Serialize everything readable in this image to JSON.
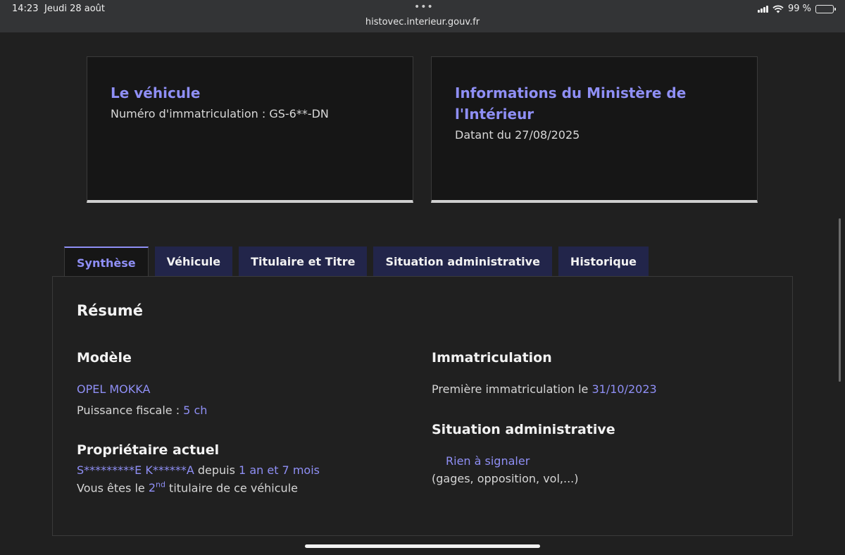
{
  "status_bar": {
    "time": "14:23",
    "date": "Jeudi 28 août",
    "battery": "99 %",
    "url": "histovec.interieur.gouv.fr"
  },
  "cards": {
    "vehicle": {
      "title": "Le véhicule",
      "text": "Numéro d'immatriculation : GS-6**-DN"
    },
    "ministry": {
      "title_line1": "Informations du Ministère de",
      "title_line2": "l'Intérieur",
      "text": "Datant du 27/08/2025"
    }
  },
  "tabs": [
    "Synthèse",
    "Véhicule",
    "Titulaire et Titre",
    "Situation administrative",
    "Historique"
  ],
  "summary": {
    "title": "Résumé",
    "model": {
      "heading": "Modèle",
      "name": "OPEL MOKKA",
      "power_label": "Puissance fiscale : ",
      "power_value": "5 ch"
    },
    "owner": {
      "heading": "Propriétaire actuel",
      "name": "S*********E K******A",
      "since_label": " depuis ",
      "since_value": "1 an et 7 mois",
      "rank_prefix": "Vous êtes le ",
      "rank_value": "2",
      "rank_sup": "nd",
      "rank_suffix": " titulaire de ce véhicule"
    },
    "registration": {
      "heading": "Immatriculation",
      "first_label": "Première immatriculation le ",
      "first_date": "31/10/2023"
    },
    "admin": {
      "heading": "Situation administrative",
      "status": "Rien à signaler",
      "detail": "(gages, opposition, vol,...)"
    }
  },
  "colors": {
    "accent": "#8f8ff5",
    "tab_bg": "#22254a",
    "card_bg": "#161616",
    "page_bg": "#202020"
  }
}
